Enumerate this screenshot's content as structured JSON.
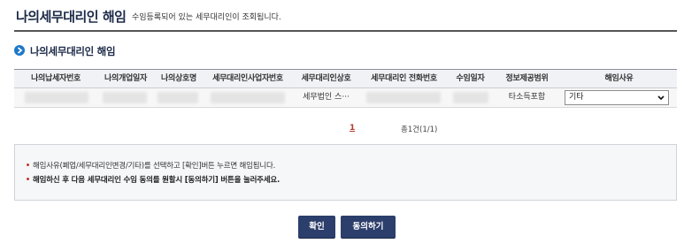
{
  "header": {
    "title": "나의세무대리인 해임",
    "description": "수임등록되어 있는 세무대리인이 조회됩니다."
  },
  "section": {
    "title": "나의세무대리인 해임",
    "icon": "arrow-circle-icon"
  },
  "table": {
    "columns": [
      "나의납세자번호",
      "나의개업일자",
      "나의상호명",
      "세무대리인사업자번호",
      "세무대리인상호",
      "세무대리인 전화번호",
      "수임일자",
      "정보제공범위",
      "해임사유"
    ],
    "rows": [
      {
        "agent_name": "세무법인 스···",
        "scope": "타소득포함",
        "reason": "기타"
      }
    ]
  },
  "pagination": {
    "current_page": "1",
    "total_text": "총1건(1/1)"
  },
  "notice": {
    "line1": "해임사유(폐업/세무대리인변경/기타)를 선택하고 [확인]버튼 누르면 해임됩니다.",
    "line2": "해임하신 후 다음 세무대리인 수임 동의를 원할시 [동의하기] 버튼을 눌러주세요."
  },
  "buttons": {
    "confirm": "확인",
    "agree": "동의하기"
  },
  "colors": {
    "title": "#1c2a48",
    "accent": "#1e78c8",
    "button": "#2c3e6b",
    "page_link": "#b03b2e"
  }
}
